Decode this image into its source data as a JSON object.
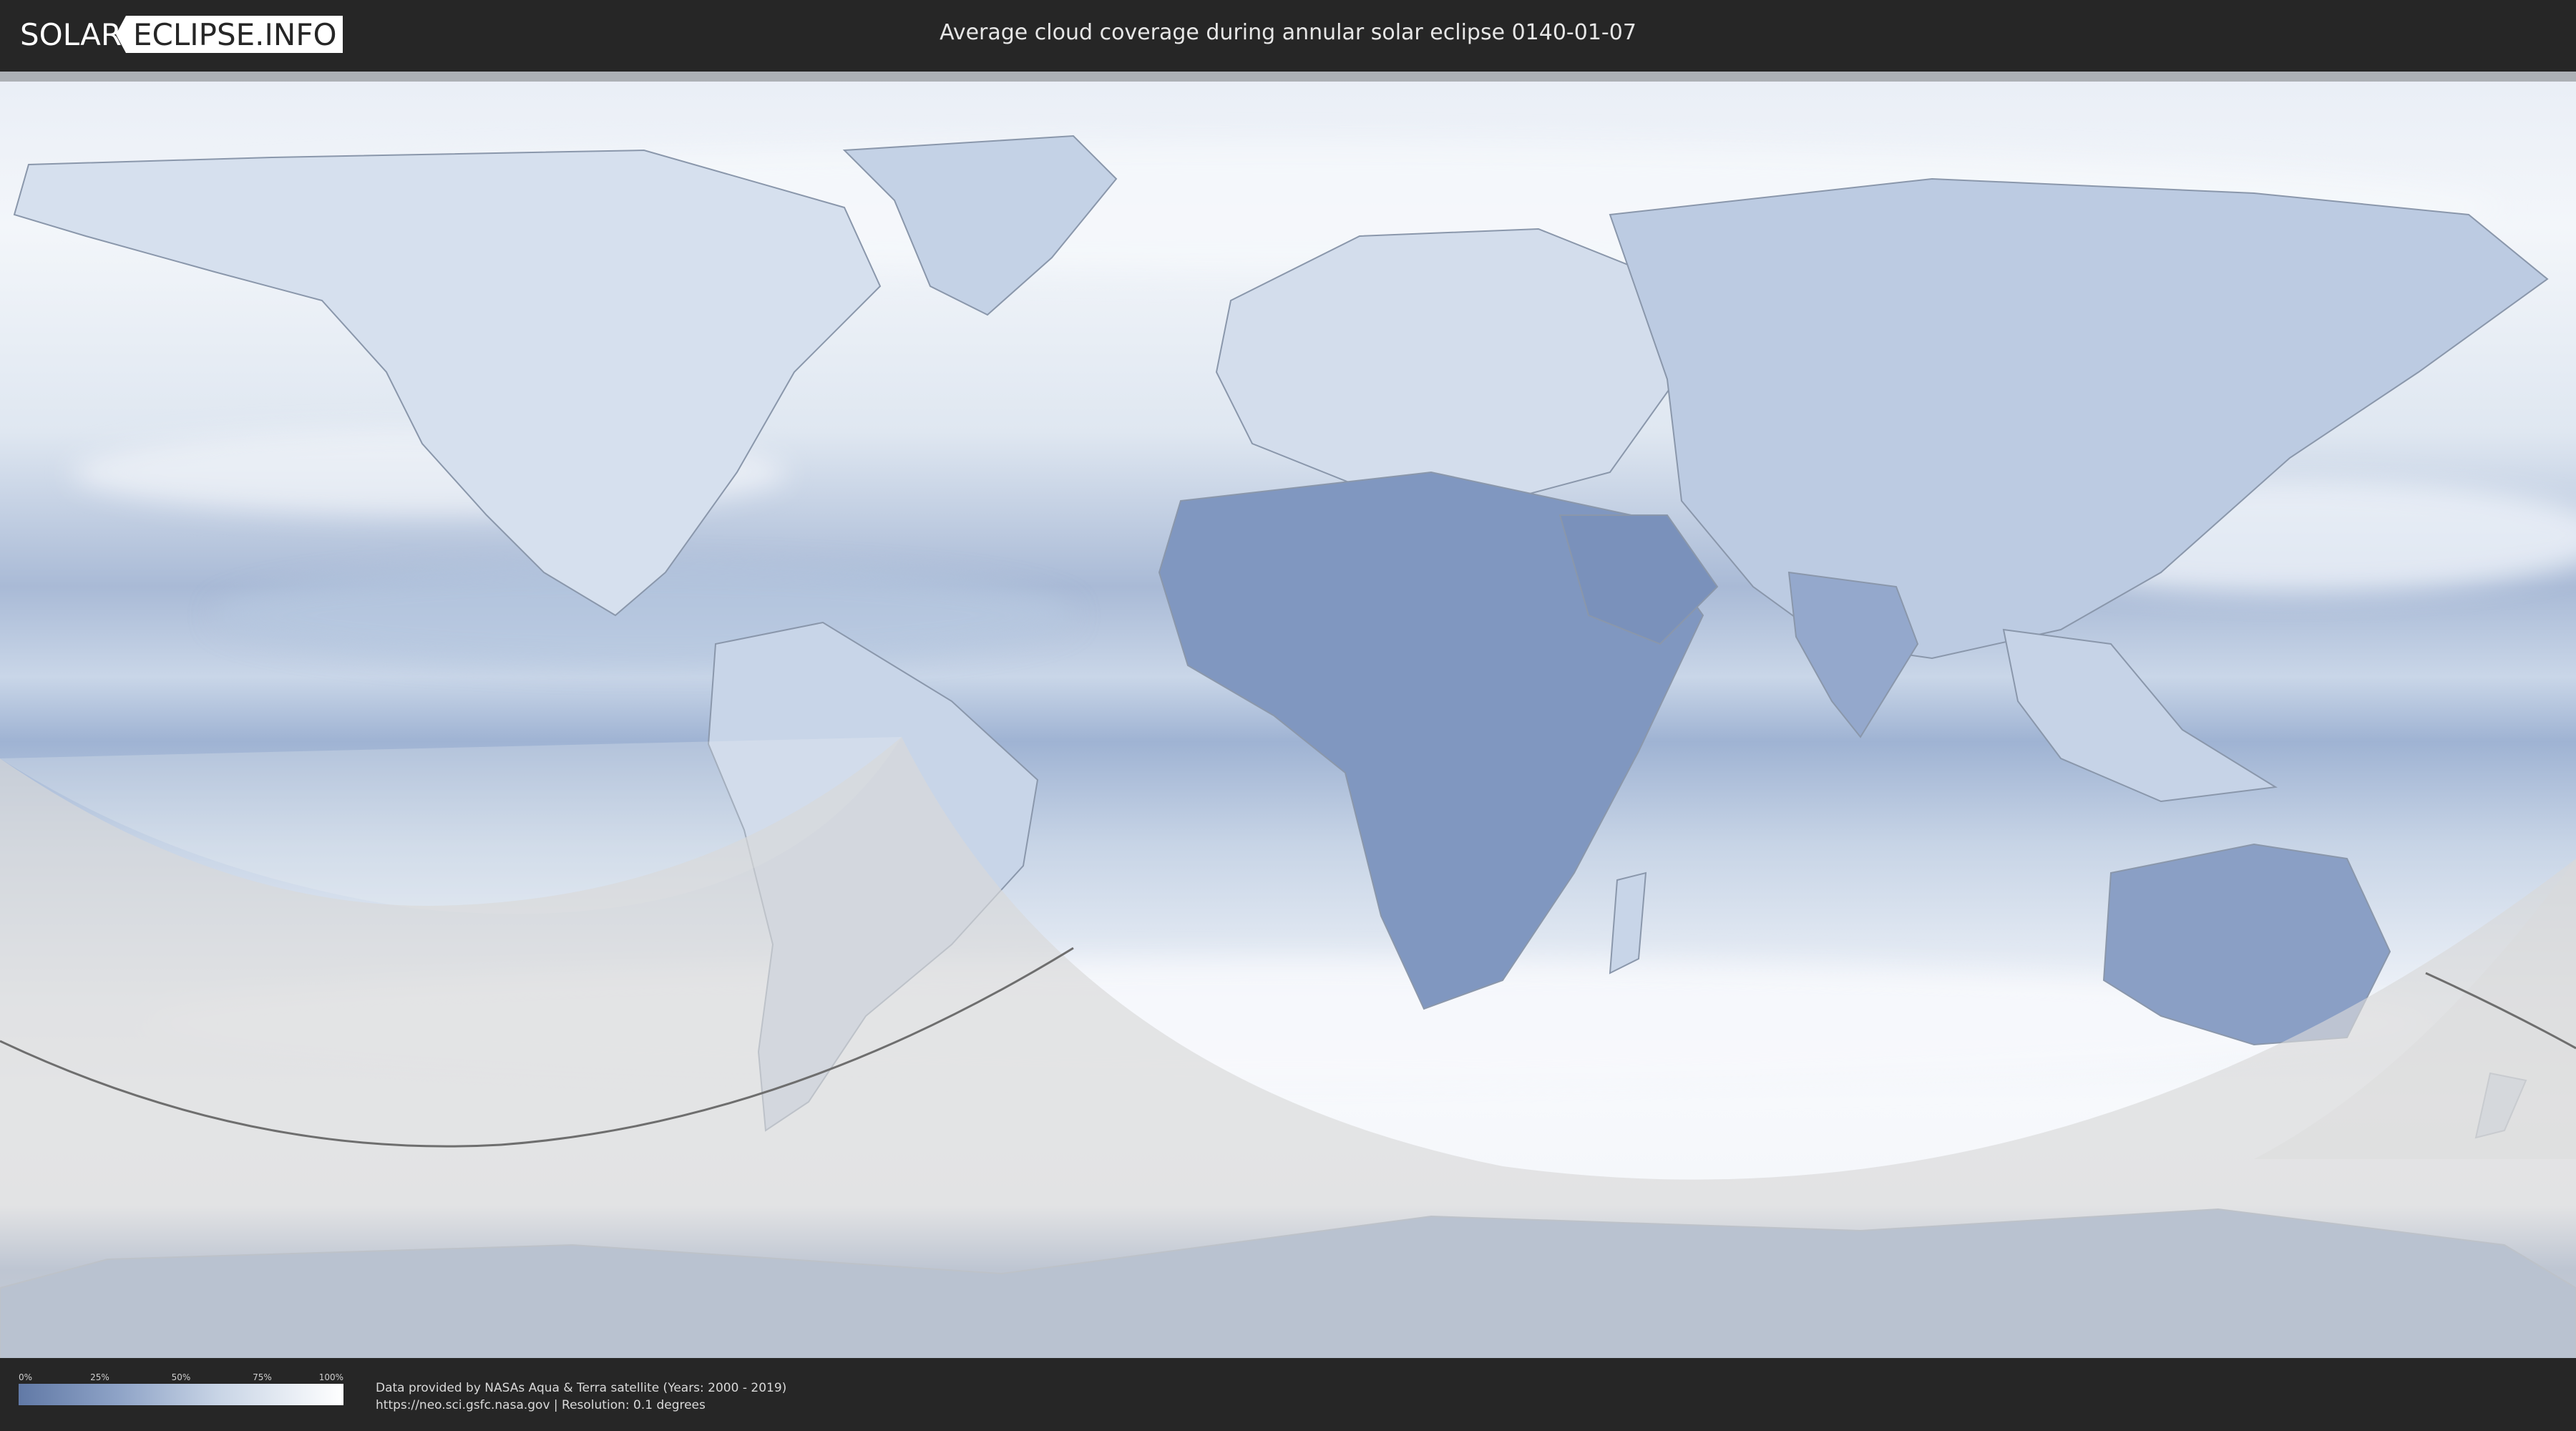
{
  "header": {
    "logo_left": "SOLAR",
    "logo_right": "ECLIPSE.INFO",
    "title": "Average cloud coverage during annular solar eclipse 0140-01-07"
  },
  "map": {
    "projection": "equirectangular",
    "colors": {
      "ocean_clear": "#7e97c0",
      "cloud": "#f2f6fb",
      "land_border": "#8a97ab",
      "night_shade": "#d9d9d9",
      "eclipse_path": "#6e6e6e"
    }
  },
  "legend": {
    "ticks": [
      "0%",
      "25%",
      "50%",
      "75%",
      "100%"
    ],
    "colors": {
      "low": "#6179a6",
      "high": "#ffffff"
    }
  },
  "credits": {
    "line1": "Data provided by NASAs Aqua & Terra satellite (Years: 2000 - 2019)",
    "line2": "https://neo.sci.gsfc.nasa.gov | Resolution: 0.1 degrees"
  }
}
